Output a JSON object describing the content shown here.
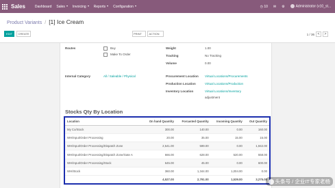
{
  "navbar": {
    "brand": "Sales",
    "menu": [
      {
        "label": "Dashboard",
        "dropdown": false
      },
      {
        "label": "Sales",
        "dropdown": true
      },
      {
        "label": "Invoicing",
        "dropdown": true
      },
      {
        "label": "Reports",
        "dropdown": true
      },
      {
        "label": "Configuration",
        "dropdown": true
      }
    ],
    "message_count": "10",
    "user": "Administrator (v10_st..."
  },
  "breadcrumb": {
    "parent": "Product Variants",
    "separator": "/",
    "current": "[1] Ice Cream"
  },
  "buttons": {
    "edit": "EDIT",
    "create": "CREATE",
    "print": "PRINT",
    "action": "ACTION"
  },
  "pager": {
    "value": "1 / 36",
    "prev": "<",
    "next": ">"
  },
  "form": {
    "routes_label": "Routes",
    "route_buy": "Buy",
    "route_mto": "Make To Order",
    "weight_label": "Weight",
    "weight_value": "1.00",
    "tracking_label": "Tracking",
    "tracking_value": "No Tracking",
    "volume_label": "Volume",
    "volume_value": "0.00",
    "internal_category_label": "Internal Category",
    "internal_category_value": "All / Saleable / Physical",
    "procurement_location_label": "Procurement Location",
    "procurement_location_value": "Virtual Locations/Procurements",
    "production_location_label": "Production Location",
    "production_location_value": "Virtual Locations/Production",
    "inventory_location_label": "Inventory Location",
    "inventory_location_value": "Virtual Locations/Inventory",
    "inventory_location_extra": "adjustment"
  },
  "stock_section": {
    "title": "Stocks Qty By Location",
    "columns": [
      "Location",
      "On hand Quantity",
      "Forcasted Quantity",
      "Incoming Quantity",
      "Out Quantity"
    ],
    "rows": [
      [
        "My Co/Stock",
        "300.00",
        "140.00",
        "0.00",
        "160.00"
      ],
      [
        "WH/Input/Order Processing",
        "20.00",
        "35.00",
        "15.00",
        "15.00"
      ],
      [
        "WH/Input/Order Processing/Dispatch Zone",
        "2,541.00",
        "599.00",
        "0.00",
        "1,942.00"
      ],
      [
        "WH/Input/Order Processing/Dispatch Zone/Gate A",
        "666.00",
        "628.00",
        "520.00",
        "558.00"
      ],
      [
        "WH/Input/Order Processing/Stock",
        "645.00",
        "45.00",
        "0.00",
        "600.00"
      ],
      [
        "WH/Stock",
        "360.00",
        "1,344.00",
        "1,004.00",
        "0.00"
      ]
    ],
    "totals": [
      "",
      "4,527.00",
      "2,791.00",
      "1,539.00",
      "3,275.00"
    ]
  },
  "watermark": "头条号 / 企业IT专家老杨",
  "colors": {
    "navbar": "#875a7b",
    "primary": "#00a09d",
    "link": "#00a09d",
    "highlight_border": "#1a2dad"
  }
}
